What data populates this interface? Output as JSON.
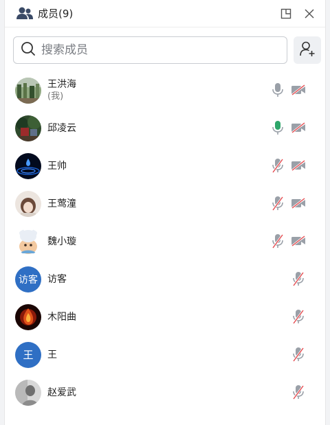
{
  "header": {
    "icon": "people-icon",
    "title": "成员(9)",
    "popout_icon": "popout-icon",
    "close_icon": "close-icon"
  },
  "search": {
    "placeholder": "搜索成员",
    "icon": "search-icon",
    "invite_icon": "add-member-icon"
  },
  "colors": {
    "mic_on": "#2ea66a",
    "muted_slash": "#e5484d",
    "device_gray": "#9aa0a8",
    "text_avatar_bg": "#2f6fc4"
  },
  "members": [
    {
      "name": "王洪海",
      "sub": "(我)",
      "avatar": "photo-landscape",
      "mic": "idle",
      "cam": "off"
    },
    {
      "name": "邱凌云",
      "avatar": "photo-forest",
      "mic": "speaking",
      "cam": "off"
    },
    {
      "name": "王帅",
      "avatar": "photo-blue-drop",
      "mic": "muted",
      "cam": "off"
    },
    {
      "name": "王莺潼",
      "avatar": "photo-portrait",
      "mic": "muted",
      "cam": "off"
    },
    {
      "name": "魏小璇",
      "avatar": "photo-cartoon",
      "mic": "muted",
      "cam": "off"
    },
    {
      "name": "访客",
      "avatar_text": "访客",
      "mic": "muted"
    },
    {
      "name": "木阳曲",
      "avatar": "photo-fire",
      "mic": "muted"
    },
    {
      "name": "王",
      "avatar_text": "王",
      "mic": "muted"
    },
    {
      "name": "赵爱武",
      "avatar": "photo-grayscale",
      "mic": "muted"
    }
  ]
}
